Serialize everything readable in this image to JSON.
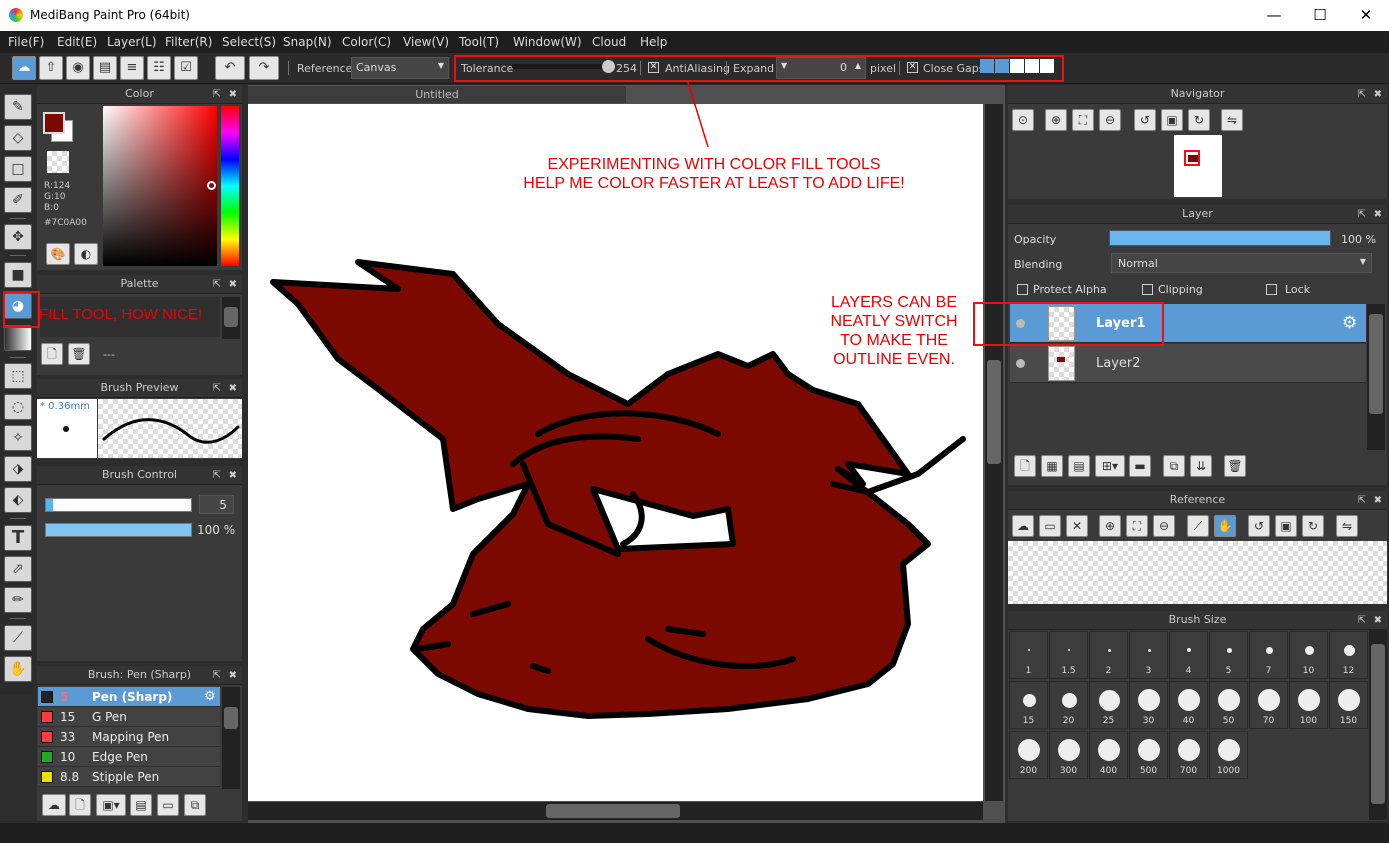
{
  "window": {
    "title": "MediBang Paint Pro (64bit)",
    "minimize": "—",
    "maximize": "☐",
    "close": "✕"
  },
  "menu": [
    "File(F)",
    "Edit(E)",
    "Layer(L)",
    "Filter(R)",
    "Select(S)",
    "Snap(N)",
    "Color(C)",
    "View(V)",
    "Tool(T)",
    "Window(W)",
    "Cloud",
    "Help"
  ],
  "toolbar": {
    "reference_label": "Reference",
    "reference_value": "Canvas",
    "tolerance_label": "Tolerance",
    "tolerance_value": "254",
    "tolerance_level": 0.99,
    "antialiasing_label": "AntiAliasing",
    "antialiasing_checked": "✕",
    "expand_label": "Expand",
    "expand_value": "0",
    "expand_unit": "pixel",
    "close_gaps_label": "Close Gaps",
    "close_gaps_checked": "✕"
  },
  "annotations": {
    "fill_colors_line1": "EXPERIMENTING WITH COLOR FILL TOOLS",
    "fill_colors_line2": "HELP ME COLOR FASTER AT LEAST TO ADD LIFE!",
    "fill_tool": "FILL TOOL, HOW NICE!",
    "layers_line1": "LAYERS CAN BE",
    "layers_line2": "NEATLY SWITCH",
    "layers_line3": "TO MAKE THE",
    "layers_line4": "OUTLINE EVEN."
  },
  "color_panel": {
    "title": "Color",
    "r": "R:124",
    "g": "G:10",
    "b": "B:0",
    "hex": "#7C0A00",
    "primary_color": "#7c0a00"
  },
  "palette_panel": {
    "title": "Palette",
    "name": "---"
  },
  "brush_preview_panel": {
    "title": "Brush Preview",
    "size": "* 0.36mm"
  },
  "brush_control_panel": {
    "title": "Brush Control",
    "size_value": "5",
    "opacity_value": "100 %",
    "size_level": 0.05,
    "opacity_level": 1.0
  },
  "brush_panel": {
    "title": "Brush: Pen (Sharp)",
    "items": [
      {
        "size": "5",
        "name": "Pen (Sharp)",
        "color": "#222222"
      },
      {
        "size": "15",
        "name": "G Pen",
        "color": "#ff3b3b"
      },
      {
        "size": "33",
        "name": "Mapping Pen",
        "color": "#ff3b3b"
      },
      {
        "size": "10",
        "name": "Edge Pen",
        "color": "#22aa22"
      },
      {
        "size": "8.8",
        "name": "Stipple Pen",
        "color": "#eedd00"
      }
    ]
  },
  "document": {
    "tab": "Untitled"
  },
  "navigator_panel": {
    "title": "Navigator"
  },
  "layer_panel": {
    "title": "Layer",
    "opacity_label": "Opacity",
    "opacity_value": "100 %",
    "opacity_level": 1.0,
    "blending_label": "Blending",
    "blending_value": "Normal",
    "protect_alpha": "Protect Alpha",
    "clipping": "Clipping",
    "lock": "Lock",
    "layers": [
      {
        "name": "Layer1"
      },
      {
        "name": "Layer2"
      }
    ]
  },
  "reference_panel": {
    "title": "Reference"
  },
  "brush_size_panel": {
    "title": "Brush Size",
    "sizes": [
      "1",
      "1.5",
      "2",
      "3",
      "4",
      "5",
      "7",
      "10",
      "12",
      "15",
      "20",
      "25",
      "30",
      "40",
      "50",
      "70",
      "100",
      "150",
      "200",
      "300",
      "400",
      "500",
      "700",
      "1000"
    ]
  },
  "icons": {
    "cloud": "☁",
    "undo": "↶",
    "redo": "↷",
    "gear": "⚙",
    "new": "🗋",
    "trash": "🗑",
    "folder": "📁",
    "eye": "●",
    "zoom_in": "⊕",
    "zoom_out": "⊖",
    "text": "T",
    "hand": "✋",
    "pin": "⇱",
    "close": "✖"
  }
}
